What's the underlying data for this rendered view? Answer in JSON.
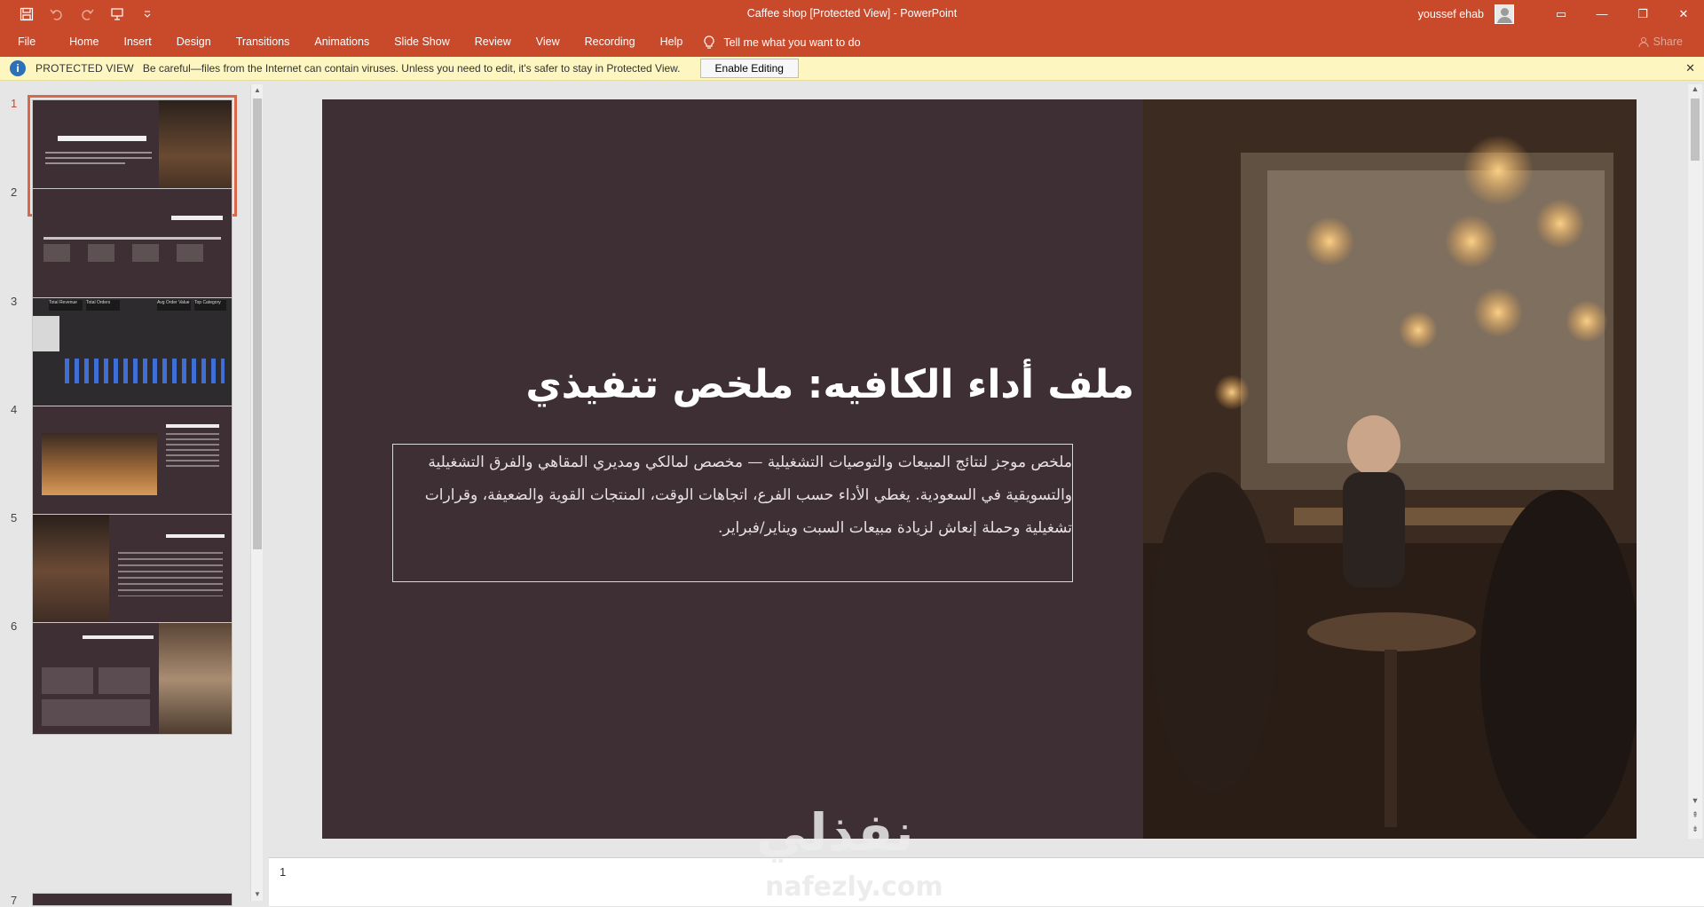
{
  "window": {
    "title": "Caffee shop [Protected View]  -  PowerPoint",
    "user": "youssef ehab",
    "controls": {
      "ribbon_display": "▭",
      "minimize": "—",
      "restore": "❐",
      "close": "✕"
    }
  },
  "ribbon": {
    "tabs": [
      "File",
      "Home",
      "Insert",
      "Design",
      "Transitions",
      "Animations",
      "Slide Show",
      "Review",
      "View",
      "Recording",
      "Help"
    ],
    "tell_me": "Tell me what you want to do",
    "share": "Share"
  },
  "protected_view": {
    "title": "PROTECTED VIEW",
    "message": "Be careful—files from the Internet can contain viruses. Unless you need to edit, it's safer to stay in Protected View.",
    "button": "Enable Editing",
    "close": "✕"
  },
  "thumbnails": {
    "numbers": [
      "1",
      "2",
      "3",
      "4",
      "5",
      "6",
      "7"
    ],
    "selected": 1,
    "slide3_labels": {
      "revenue": "Total Revenue",
      "orders": "Total Orders",
      "aov": "Avg Order Value",
      "category": "Top Category"
    }
  },
  "slide": {
    "title": "ملف أداء الكافيه: ملخص تنفيذي",
    "body": "ملخص موجز لنتائج المبيعات والتوصيات التشغيلية — مخصص لمالكي ومديري المقاهي والفرق التشغيلية والتسويقية في السعودية. يغطي الأداء حسب الفرع، اتجاهات الوقت، المنتجات القوية والضعيفة، وقرارات تشغيلية وحملة إنعاش لزيادة مبيعات السبت ويناير/فبراير."
  },
  "status": {
    "page_number": "1"
  },
  "watermark": {
    "arabic": "نفذلي",
    "latin": "nafezly.com"
  },
  "colors": {
    "accent": "#c9492b",
    "slide_bg": "#3d2f33",
    "pv_bg": "#fdf6c1",
    "selected_outline": "#d9684a"
  }
}
